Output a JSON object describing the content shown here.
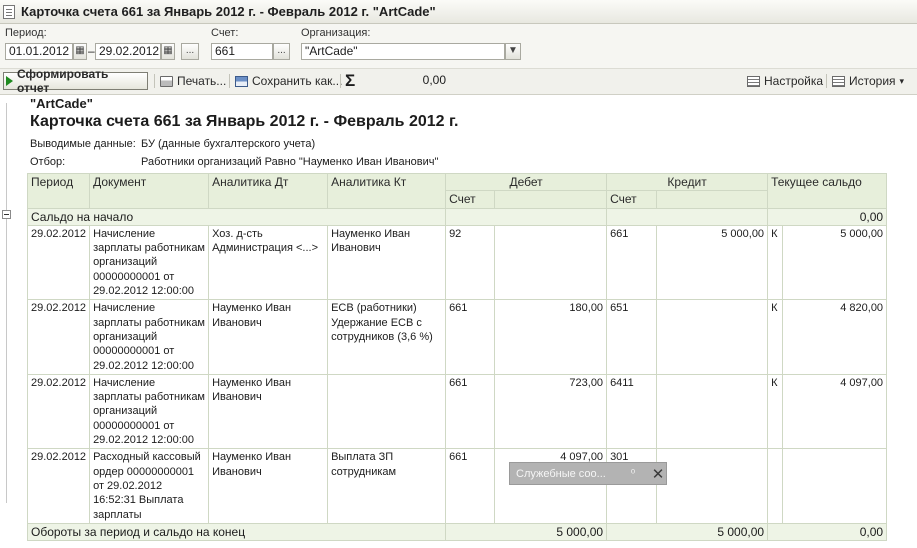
{
  "window": {
    "title": "Карточка счета 661 за Январь 2012 г. - Февраль 2012 г. \"ArtCade\""
  },
  "filters": {
    "period_label": "Период:",
    "date_from": "01.01.2012",
    "dash": "–",
    "date_to": "29.02.2012",
    "select_button": "...",
    "account_label": "Счет:",
    "account": "661",
    "org_label": "Организация:",
    "organization": "\"ArtCade\""
  },
  "toolbar": {
    "generate": "Сформировать отчет",
    "print": "Печать...",
    "save": "Сохранить как...",
    "sum_symbol": "Σ",
    "sum_value": "0,00",
    "settings": "Настройка",
    "history": "История"
  },
  "report": {
    "org": "\"ArtCade\"",
    "title": "Карточка счета 661 за Январь 2012 г. - Февраль 2012 г.",
    "output_label": "Выводимые данные:",
    "output_value": "БУ (данные бухгалтерского учета)",
    "filter_label": "Отбор:",
    "filter_value": "Работники организаций Равно \"Науменко Иван Иванович\"",
    "headers": {
      "period": "Период",
      "document": "Документ",
      "analytics_dt": "Аналитика Дт",
      "analytics_kt": "Аналитика Кт",
      "debit": "Дебет",
      "credit": "Кредит",
      "balance": "Текущее сальдо",
      "account": "Счет"
    },
    "opening": {
      "label": "Сальдо на начало",
      "value": "0,00"
    },
    "rows": [
      {
        "period": "29.02.2012",
        "document": "Начисление зарплаты работникам организаций 00000000001 от 29.02.2012 12:00:00",
        "analytics_dt": "Хоз. д-сть Администрация <...>",
        "analytics_kt": "Науменко Иван Иванович",
        "debit_account": "92",
        "debit_amount": "",
        "credit_account": "661",
        "credit_amount": "5 000,00",
        "balance_side": "К",
        "balance_amount": "5 000,00"
      },
      {
        "period": "29.02.2012",
        "document": "Начисление зарплаты работникам организаций 00000000001 от 29.02.2012 12:00:00",
        "analytics_dt": "Науменко Иван Иванович",
        "analytics_kt": "ЕСВ (работники) Удержание ЕСВ с сотрудников (3,6 %)",
        "debit_account": "661",
        "debit_amount": "180,00",
        "credit_account": "651",
        "credit_amount": "",
        "balance_side": "К",
        "balance_amount": "4 820,00"
      },
      {
        "period": "29.02.2012",
        "document": "Начисление зарплаты работникам организаций 00000000001 от 29.02.2012 12:00:00",
        "analytics_dt": "Науменко Иван Иванович",
        "analytics_kt": "",
        "debit_account": "661",
        "debit_amount": "723,00",
        "credit_account": "6411",
        "credit_amount": "",
        "balance_side": "К",
        "balance_amount": "4 097,00"
      },
      {
        "period": "29.02.2012",
        "document": "Расходный кассовый ордер 00000000001 от 29.02.2012 16:52:31 Выплата зарплаты",
        "analytics_dt": "Науменко Иван Иванович",
        "analytics_kt": "Выплата ЗП сотрудникам",
        "debit_account": "661",
        "debit_amount": "4 097,00",
        "credit_account": "301",
        "credit_amount": "",
        "balance_side": "",
        "balance_amount": ""
      }
    ],
    "totals": {
      "label": "Обороты за период и сальдо на конец",
      "debit": "5 000,00",
      "credit": "5 000,00",
      "balance": "0,00"
    }
  },
  "popup": {
    "label": "Служебные соо...",
    "pin": "⁰",
    "close": "✕"
  }
}
